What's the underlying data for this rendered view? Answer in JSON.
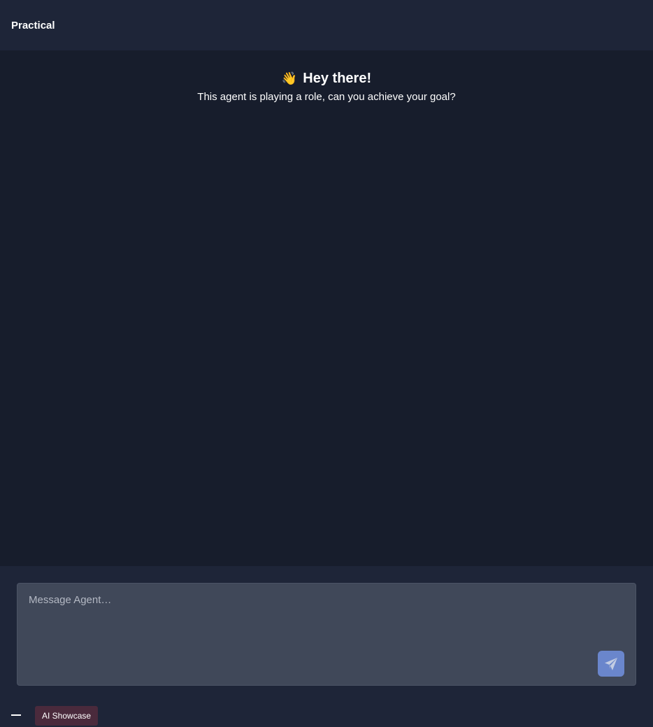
{
  "header": {
    "title": "Practical"
  },
  "welcome": {
    "icon": "waving-hand-icon",
    "emoji": "👋",
    "title": "Hey there!",
    "subtitle": "This agent is playing a role, can you achieve your goal?"
  },
  "composer": {
    "placeholder": "Message Agent…",
    "send_icon": "paper-plane-icon"
  },
  "footer": {
    "minimize_icon": "minus-icon",
    "badge_label": "AI Showcase"
  },
  "colors": {
    "background": "#171d2c",
    "panel": "#1e2538",
    "input": "#404859",
    "send_button": "#6a86cc",
    "badge": "#4a2a3c"
  }
}
